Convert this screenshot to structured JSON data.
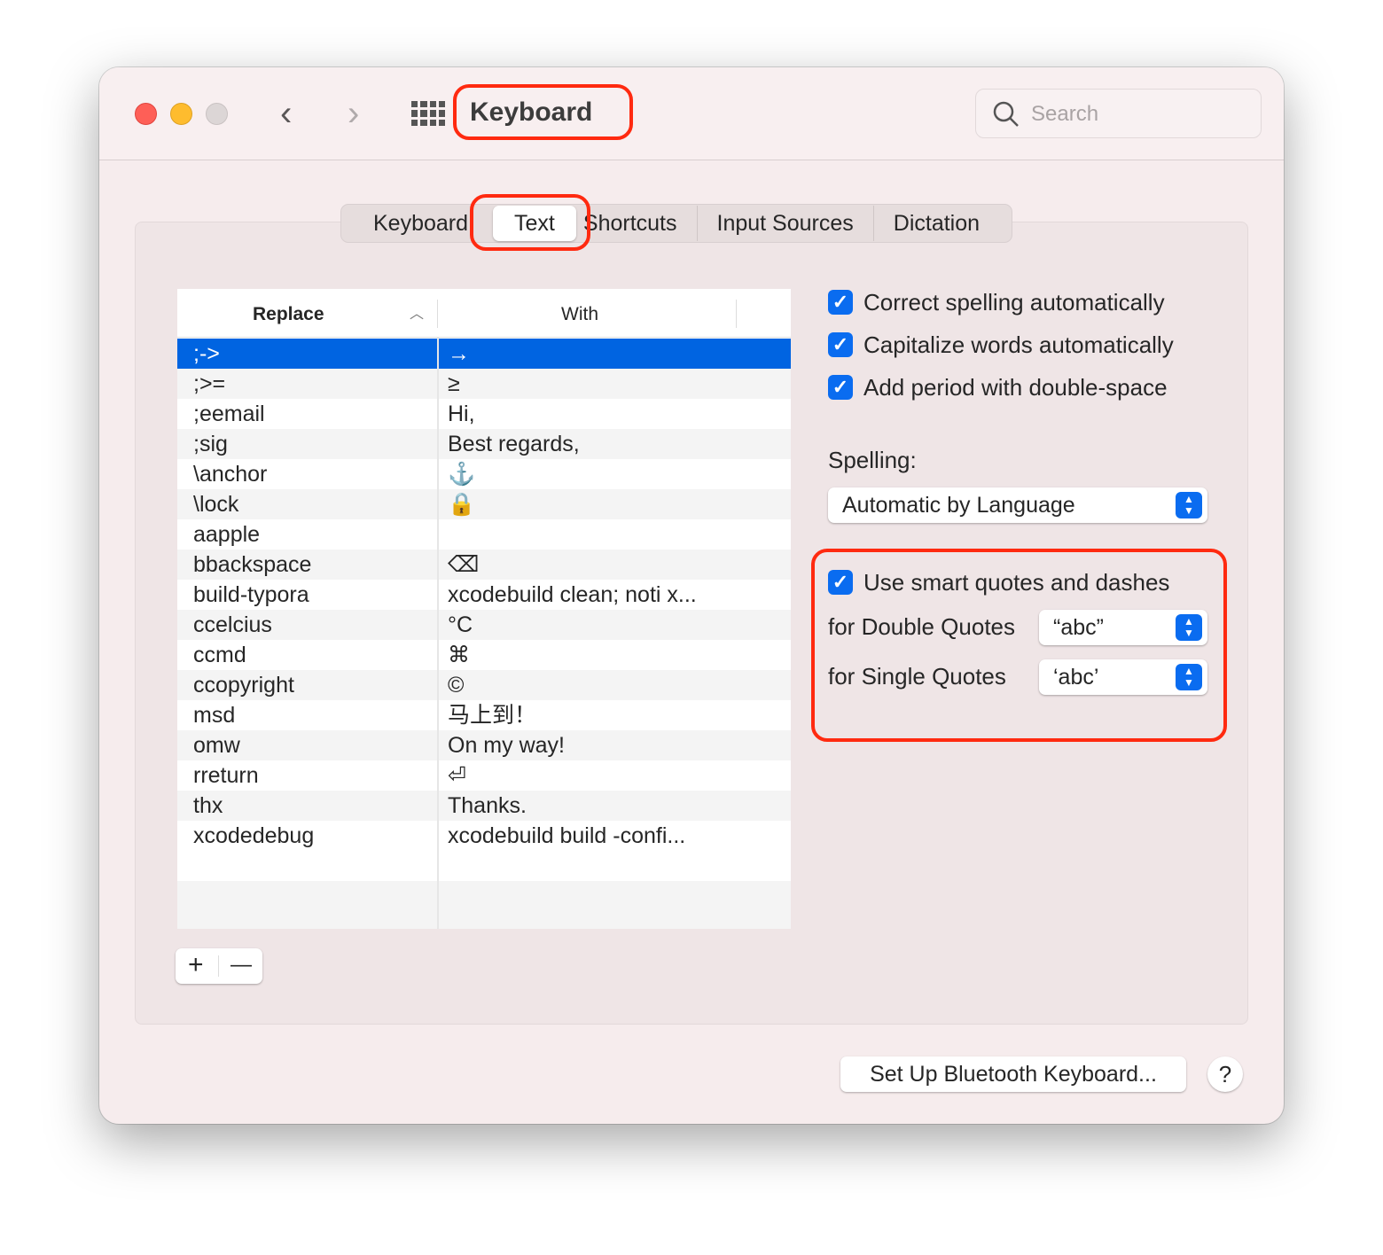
{
  "window": {
    "title": "Keyboard",
    "search_placeholder": "Search",
    "colors": {
      "close": "#fe5f57",
      "minimize": "#febc2e",
      "zoom": "#dcd6d6",
      "accent": "#0064e1",
      "highlight": "#ff2a10"
    }
  },
  "tabs": [
    {
      "label": "Keyboard"
    },
    {
      "label": "Text",
      "selected": true
    },
    {
      "label": "Shortcuts"
    },
    {
      "label": "Input Sources"
    },
    {
      "label": "Dictation"
    }
  ],
  "table": {
    "columns": {
      "replace": "Replace",
      "with": "With"
    },
    "sort": "ascending",
    "rows": [
      {
        "replace": ";->",
        "with": "→"
      },
      {
        "replace": ";>=",
        "with": "≥"
      },
      {
        "replace": ";eemail",
        "with": "Hi,"
      },
      {
        "replace": ";sig",
        "with": "Best regards,"
      },
      {
        "replace": "\\anchor",
        "with": "⚓"
      },
      {
        "replace": "\\lock",
        "with": "🔒"
      },
      {
        "replace": "aapple",
        "with": ""
      },
      {
        "replace": "bbackspace",
        "with": "⌫"
      },
      {
        "replace": "build-typora",
        "with": "xcodebuild clean; noti x..."
      },
      {
        "replace": "ccelcius",
        "with": "°C"
      },
      {
        "replace": "ccmd",
        "with": "⌘"
      },
      {
        "replace": "ccopyright",
        "with": "©"
      },
      {
        "replace": "msd",
        "with": "马上到！"
      },
      {
        "replace": "omw",
        "with": "On my way!"
      },
      {
        "replace": "rreturn",
        "with": "⏎"
      },
      {
        "replace": "thx",
        "with": "Thanks."
      },
      {
        "replace": "xcodedebug",
        "with": "xcodebuild build -confi..."
      }
    ]
  },
  "options": {
    "correct_spelling": {
      "label": "Correct spelling automatically",
      "checked": true
    },
    "capitalize": {
      "label": "Capitalize words automatically",
      "checked": true
    },
    "period": {
      "label": "Add period with double-space",
      "checked": true
    },
    "spelling_label": "Spelling:",
    "spelling_value": "Automatic by Language",
    "smart_quotes": {
      "label": "Use smart quotes and dashes",
      "checked": true
    },
    "double_label": "for Double Quotes",
    "double_value": "“abc”",
    "single_label": "for Single Quotes",
    "single_value": "‘abc’"
  },
  "buttons": {
    "add": "+",
    "remove": "—",
    "bluetooth": "Set Up Bluetooth Keyboard...",
    "help": "?"
  }
}
